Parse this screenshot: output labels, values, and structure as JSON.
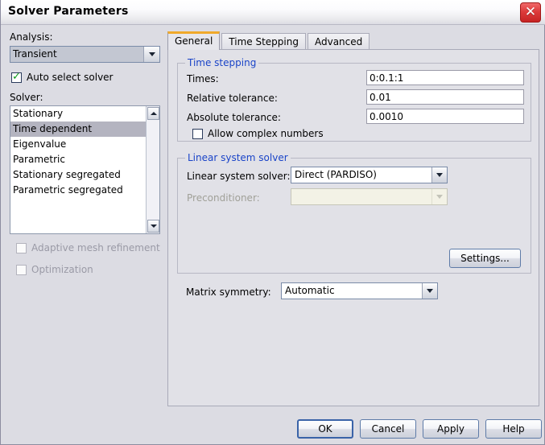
{
  "window": {
    "title": "Solver Parameters",
    "close_icon": "close-icon",
    "close_glyph": "✕"
  },
  "left_panel": {
    "analysis_label": "Analysis:",
    "analysis_value": "Transient",
    "auto_select_solver_label": "Auto select solver",
    "auto_select_solver_checked": true,
    "solver_label": "Solver:",
    "solver_items": [
      "Stationary",
      "Time dependent",
      "Eigenvalue",
      "Parametric",
      "Stationary segregated",
      "Parametric segregated"
    ],
    "solver_selected": "Time dependent",
    "adaptive_mesh_label": "Adaptive mesh refinement",
    "adaptive_mesh_checked": false,
    "optimization_label": "Optimization",
    "optimization_checked": false
  },
  "tabs": [
    {
      "label": "General",
      "active": true
    },
    {
      "label": "Time Stepping",
      "active": false
    },
    {
      "label": "Advanced",
      "active": false
    }
  ],
  "general_tab": {
    "time_stepping": {
      "legend": "Time stepping",
      "times_label": "Times:",
      "times_value": "0:0.1:1",
      "relative_tolerance_label": "Relative tolerance:",
      "relative_tolerance_value": "0.01",
      "absolute_tolerance_label": "Absolute tolerance:",
      "absolute_tolerance_value": "0.0010",
      "allow_complex_label": "Allow complex numbers",
      "allow_complex_checked": false
    },
    "linear_system_solver": {
      "legend": "Linear system solver",
      "solver_label": "Linear system solver:",
      "solver_value": "Direct (PARDISO)",
      "preconditioner_label": "Preconditioner:",
      "preconditioner_value": "",
      "preconditioner_enabled": false,
      "settings_button": "Settings..."
    },
    "matrix_symmetry_label": "Matrix symmetry:",
    "matrix_symmetry_value": "Automatic"
  },
  "footer": {
    "ok": "OK",
    "cancel": "Cancel",
    "apply": "Apply",
    "help": "Help"
  },
  "colors": {
    "dialog_bg": "#dcdce3",
    "panel_bg": "#e1e1e7",
    "legend_blue": "#1a44c8",
    "active_tab_accent": "#f0a92b",
    "close_red": "#c62424",
    "check_green": "#0d9b18",
    "selection_gray": "#b4b4c0"
  }
}
